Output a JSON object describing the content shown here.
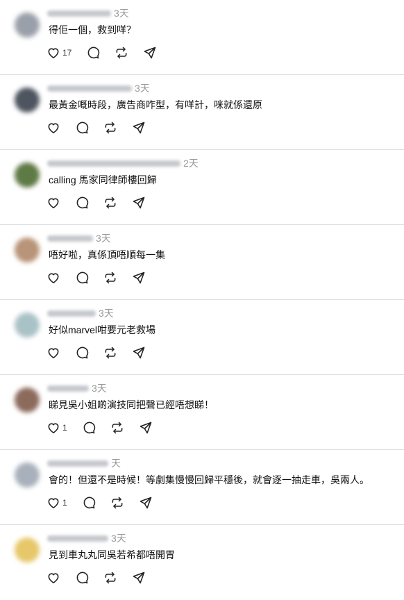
{
  "posts": [
    {
      "time": "3天",
      "text": "得佢一個，救到咩？",
      "likes": "17",
      "avatar": "#9aa0aa",
      "name_len": 92
    },
    {
      "time": "3天",
      "text": "最黃金嘅時段，廣告商咋型，有咩計，咪就係還原",
      "likes": "",
      "avatar": "#4e5560",
      "name_len": 122
    },
    {
      "time": "2天",
      "text": "calling 馬家同律師樓回歸",
      "likes": "",
      "avatar": "#5e7a45",
      "name_len": 192
    },
    {
      "time": "3天",
      "text": "唔好啦，真係頂唔順每一集",
      "likes": "",
      "avatar": "#b89478",
      "name_len": 66
    },
    {
      "time": "3天",
      "text": "好似marvel咁要元老救場",
      "likes": "",
      "avatar": "#a9c2c6",
      "name_len": 70
    },
    {
      "time": "3天",
      "text": "睇見吳小姐啲演技同把聲已經唔想睇！",
      "likes": "1",
      "avatar": "#8c6a5c",
      "name_len": 60
    },
    {
      "time": "天",
      "text": "會的！但還不是時候！等劇集慢慢回歸平穩後，就會逐一抽走車，吳兩人。",
      "likes": "1",
      "avatar": "#a8b0bc",
      "name_len": 88
    },
    {
      "time": "3天",
      "text": "見到車丸丸同吳若希都唔開胃",
      "likes": "",
      "avatar": "#e6c86a",
      "name_len": 88
    }
  ],
  "icons": {
    "like": "heart-icon",
    "reply": "comment-icon",
    "repost": "repost-icon",
    "share": "share-icon"
  }
}
